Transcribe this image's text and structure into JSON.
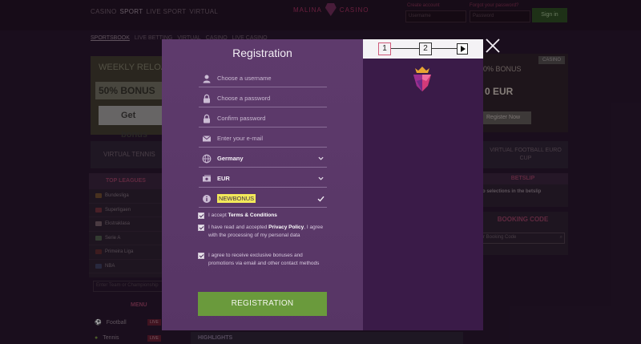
{
  "page": {
    "top_nav": [
      "CASINO",
      "SPORT",
      "LIVE SPORT",
      "VIRTUAL"
    ],
    "brand": {
      "left": "MALINA",
      "right": "CASINO"
    },
    "login": {
      "username_label": "Create account",
      "password_label": "Forgot your password?",
      "username_placeholder": "Username",
      "password_placeholder": "Password",
      "signin_label": "Sign in"
    },
    "sub_nav": [
      "SPORTSBOOK",
      "LIVE BETTING",
      "VIRTUAL",
      "CASINO",
      "LIVE CASINO"
    ],
    "promo_left": {
      "title": "WEEKLY RELOAD",
      "amount": "50% BONUS",
      "cta": "Get bonus"
    },
    "virtual_tennis": "VIRTUAL TENNIS",
    "top_leagues": {
      "title": "TOP LEAGUES",
      "items": [
        "Bundesliga",
        "Superligaen",
        "Ekstraklasa",
        "Serie A",
        "Primeira Liga",
        "NBA"
      ]
    },
    "search_teams_placeholder": "Enter Team or Championship",
    "menu": {
      "title": "MENU",
      "items": [
        {
          "label": "Football",
          "badge": "LIVE"
        },
        {
          "label": "Tennis",
          "badge": "LIVE"
        }
      ]
    },
    "promo_right": {
      "badge": "CASINO",
      "line1": "0% BONUS",
      "line2": "0 EUR",
      "cta": "Register Now"
    },
    "virtual_football": "VIRTUAL FOOTBALL EURO CUP",
    "betslip": {
      "title": "BETSLIP",
      "message": "o selections in the betslip"
    },
    "booking": {
      "title": "BOOKING CODE",
      "placeholder": "r Booking Code"
    },
    "highlights": "HIGHLIGHTS"
  },
  "modal": {
    "title": "Registration",
    "steps": [
      "1",
      "2"
    ],
    "current_step": 1,
    "fields": {
      "username": {
        "placeholder": "Choose a username",
        "icon": "user-icon"
      },
      "password": {
        "placeholder": "Choose a password",
        "icon": "lock-icon"
      },
      "confirm_password": {
        "placeholder": "Confirm password",
        "icon": "lock-icon"
      },
      "email": {
        "placeholder": "Enter your e-mail",
        "icon": "mail-icon"
      },
      "country": {
        "value": "Germany",
        "icon": "globe-icon"
      },
      "currency": {
        "value": "EUR",
        "icon": "money-icon"
      },
      "bonus_code": {
        "value": "NEWBONUS",
        "icon": "info-icon"
      }
    },
    "checkboxes": {
      "terms": {
        "prefix": "I accept ",
        "link": "Terms & Conditions",
        "suffix": "",
        "checked": true
      },
      "privacy": {
        "prefix": "I have read and accepted ",
        "link": "Privacy Policy",
        "suffix": ", I agree with the processing of my personal data",
        "checked": true
      },
      "marketing": {
        "prefix": "I agree to receive exclusive bonuses and promotions via email and other contact methods",
        "link": "",
        "suffix": "",
        "checked": true
      }
    },
    "submit_label": "REGISTRATION"
  },
  "colors": {
    "modal_bg": "#5e3a6c",
    "side_panel": "#3a1b48",
    "submit": "#6a9a3c",
    "bonus_highlight": "#f2e95a",
    "brand_pink": "#d23a79"
  }
}
